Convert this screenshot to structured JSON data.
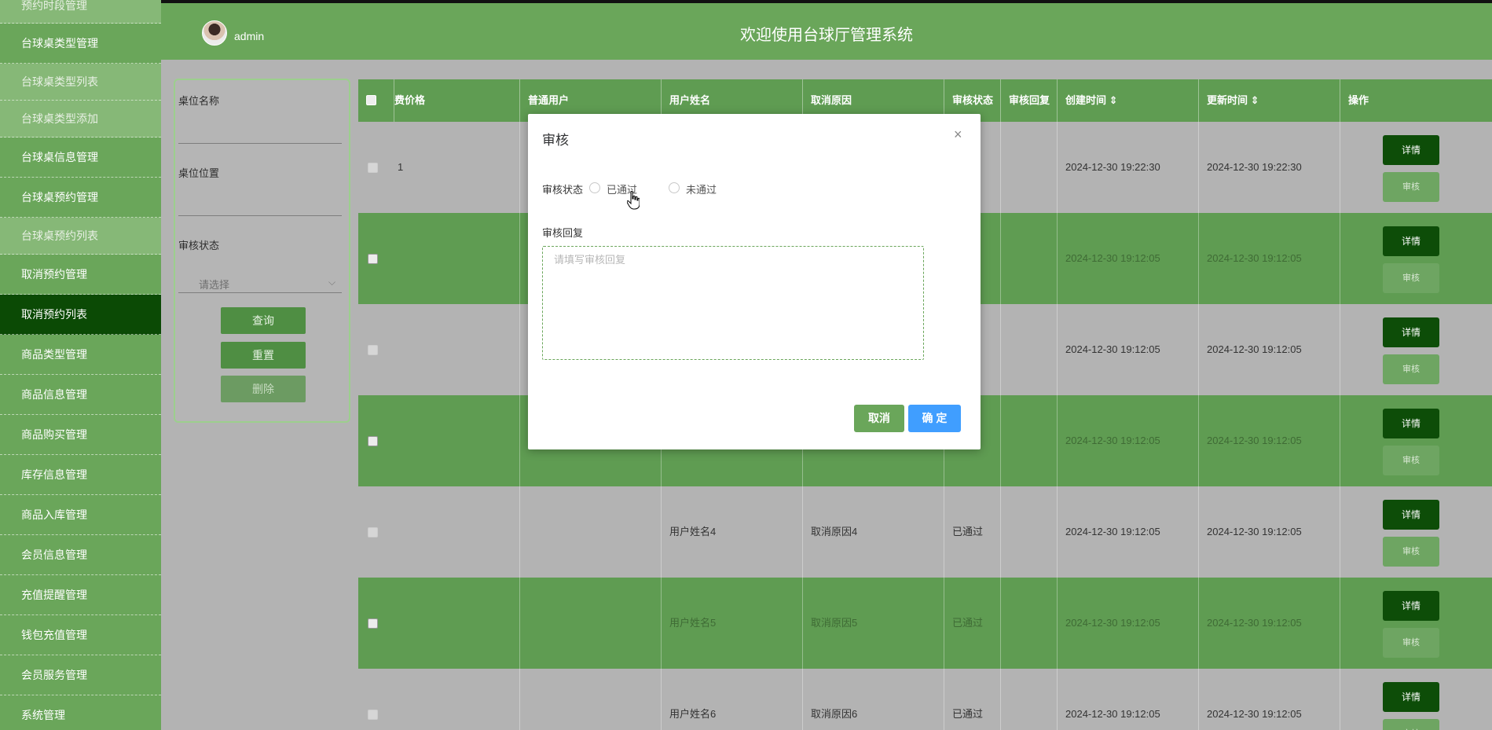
{
  "header": {
    "admin_name": "admin",
    "title": "欢迎使用台球厅管理系统"
  },
  "sidebar": {
    "items": [
      {
        "label": "预约时段管理",
        "type": "sub-top"
      },
      {
        "label": "台球桌类型管理",
        "type": "main"
      },
      {
        "label": "台球桌类型列表",
        "type": "sub"
      },
      {
        "label": "台球桌类型添加",
        "type": "sub"
      },
      {
        "label": "台球桌信息管理",
        "type": "main"
      },
      {
        "label": "台球桌预约管理",
        "type": "main"
      },
      {
        "label": "台球桌预约列表",
        "type": "sub"
      },
      {
        "label": "取消预约管理",
        "type": "main"
      },
      {
        "label": "取消预约列表",
        "type": "active"
      },
      {
        "label": "商品类型管理",
        "type": "main"
      },
      {
        "label": "商品信息管理",
        "type": "main"
      },
      {
        "label": "商品购买管理",
        "type": "main"
      },
      {
        "label": "库存信息管理",
        "type": "main"
      },
      {
        "label": "商品入库管理",
        "type": "main"
      },
      {
        "label": "会员信息管理",
        "type": "main"
      },
      {
        "label": "充值提醒管理",
        "type": "main"
      },
      {
        "label": "钱包充值管理",
        "type": "main"
      },
      {
        "label": "会员服务管理",
        "type": "main"
      },
      {
        "label": "系统管理",
        "type": "main"
      }
    ]
  },
  "search": {
    "table_name_label": "桌位名称",
    "table_location_label": "桌位位置",
    "audit_status_label": "审核状态",
    "audit_status_placeholder": "请选择",
    "query_label": "查询",
    "reset_label": "重置",
    "delete_label": "删除"
  },
  "table": {
    "headers": [
      "",
      "费价格",
      "普通用户",
      "用户姓名",
      "取消原因",
      "审核状态",
      "审核回复",
      "创建时间 ⇕",
      "更新时间 ⇕",
      "操作"
    ],
    "detail_label": "详情",
    "audit_label": "审核",
    "rows": [
      {
        "price": "1",
        "user": "",
        "name": "",
        "reason": "",
        "status": "",
        "reply": "",
        "created": "2024-12-30 19:22:30",
        "updated": "2024-12-30 19:22:30"
      },
      {
        "price": "",
        "user": "",
        "name": "",
        "reason": "",
        "status": "",
        "reply": "",
        "created": "2024-12-30 19:12:05",
        "updated": "2024-12-30 19:12:05"
      },
      {
        "price": "",
        "user": "",
        "name": "",
        "reason": "",
        "status": "",
        "reply": "",
        "created": "2024-12-30 19:12:05",
        "updated": "2024-12-30 19:12:05"
      },
      {
        "price": "",
        "user": "",
        "name": "",
        "reason": "",
        "status": "",
        "reply": "",
        "created": "2024-12-30 19:12:05",
        "updated": "2024-12-30 19:12:05"
      },
      {
        "price": "",
        "user": "",
        "name": "用户姓名4",
        "reason": "取消原因4",
        "status": "已通过",
        "reply": "",
        "created": "2024-12-30 19:12:05",
        "updated": "2024-12-30 19:12:05"
      },
      {
        "price": "",
        "user": "",
        "name": "用户姓名5",
        "reason": "取消原因5",
        "status": "已通过",
        "reply": "",
        "created": "2024-12-30 19:12:05",
        "updated": "2024-12-30 19:12:05"
      },
      {
        "price": "",
        "user": "",
        "name": "用户姓名6",
        "reason": "取消原因6",
        "status": "已通过",
        "reply": "",
        "created": "2024-12-30 19:12:05",
        "updated": "2024-12-30 19:12:05"
      }
    ]
  },
  "modal": {
    "title": "审核",
    "status_label": "审核状态",
    "option_pass": "已通过",
    "option_fail": "未通过",
    "reply_label": "审核回复",
    "reply_placeholder": "请填写审核回复",
    "cancel_label": "取消",
    "ok_label": "确 定",
    "close_symbol": "×"
  },
  "colors": {
    "primary_green": "#6aa65a",
    "dark_green": "#0d4d08",
    "confirm_blue": "#409eff"
  }
}
